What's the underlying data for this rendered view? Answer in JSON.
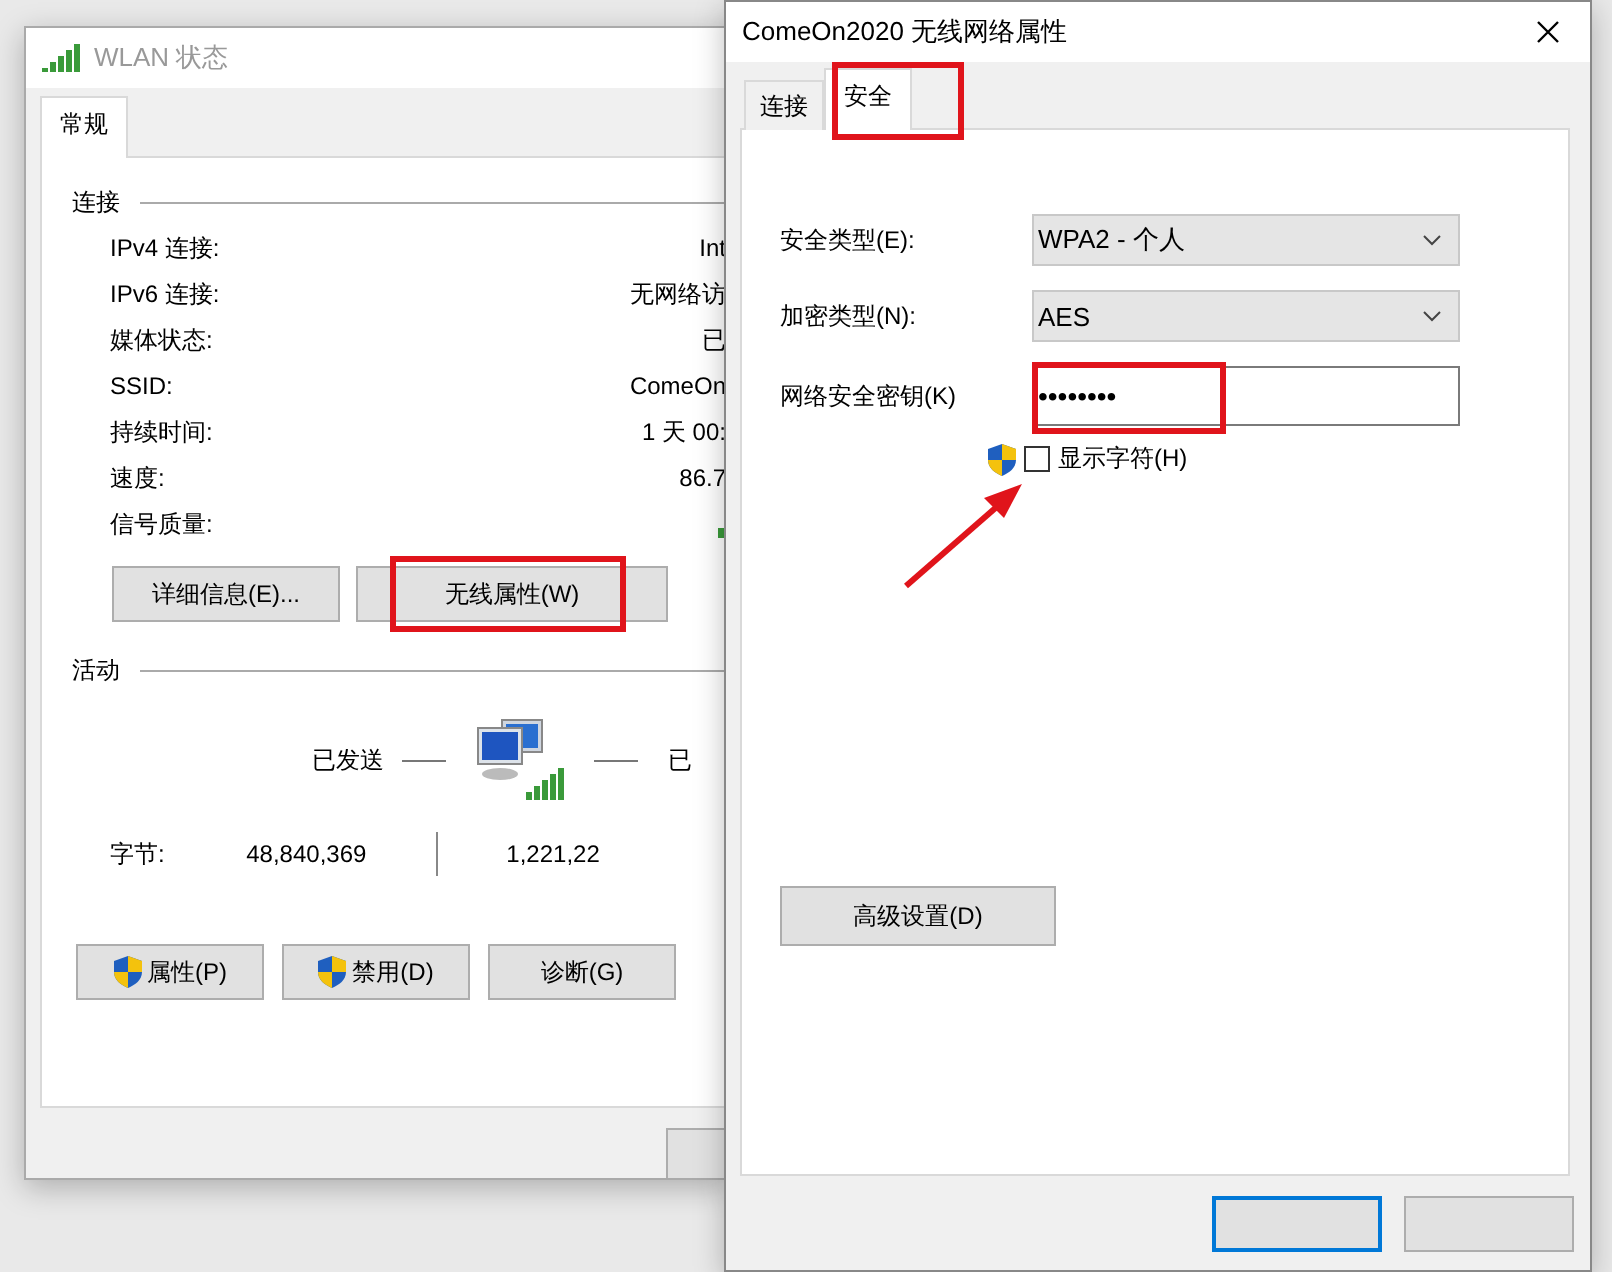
{
  "status_window": {
    "title": "WLAN 状态",
    "tabs": [
      {
        "label": "常规",
        "selected": true
      }
    ],
    "connection": {
      "heading": "连接",
      "rows": [
        {
          "label": "IPv4 连接:",
          "value": "Int"
        },
        {
          "label": "IPv6 连接:",
          "value": "无网络访"
        },
        {
          "label": "媒体状态:",
          "value": "已"
        },
        {
          "label": "SSID:",
          "value": "ComeOn"
        },
        {
          "label": "持续时间:",
          "value": "1 天 00:"
        },
        {
          "label": "速度:",
          "value": "86.7"
        },
        {
          "label": "信号质量:",
          "kind": "signal"
        }
      ]
    },
    "buttons_top": [
      {
        "label": "详细信息(E)...",
        "highlighted": false
      },
      {
        "label": "无线属性(W)",
        "highlighted": true
      }
    ],
    "activity": {
      "heading": "活动",
      "sent_label": "已发送",
      "received_label": "已",
      "bytes_label": "字节:",
      "bytes_sent": "48,840,369",
      "bytes_received": "1,221,22"
    },
    "buttons_bottom": [
      {
        "label": "属性(P)",
        "shield": true
      },
      {
        "label": "禁用(D)",
        "shield": true
      },
      {
        "label": "诊断(G)",
        "shield": false
      }
    ]
  },
  "properties_window": {
    "title": "ComeOn2020 无线网络属性",
    "tabs": [
      {
        "label": "连接",
        "selected": false,
        "highlighted": false
      },
      {
        "label": "安全",
        "selected": true,
        "highlighted": true
      }
    ],
    "fields": [
      {
        "kind": "select",
        "label": "安全类型(E):",
        "value": "WPA2 - 个人"
      },
      {
        "kind": "select",
        "label": "加密类型(N):",
        "value": "AES"
      },
      {
        "kind": "password",
        "label": "网络安全密钥(K)",
        "value": "••••••••",
        "highlighted": true
      }
    ],
    "show_characters": {
      "label": "显示字符(H)",
      "checked": false
    },
    "advanced_button": "高级设置(D)"
  }
}
